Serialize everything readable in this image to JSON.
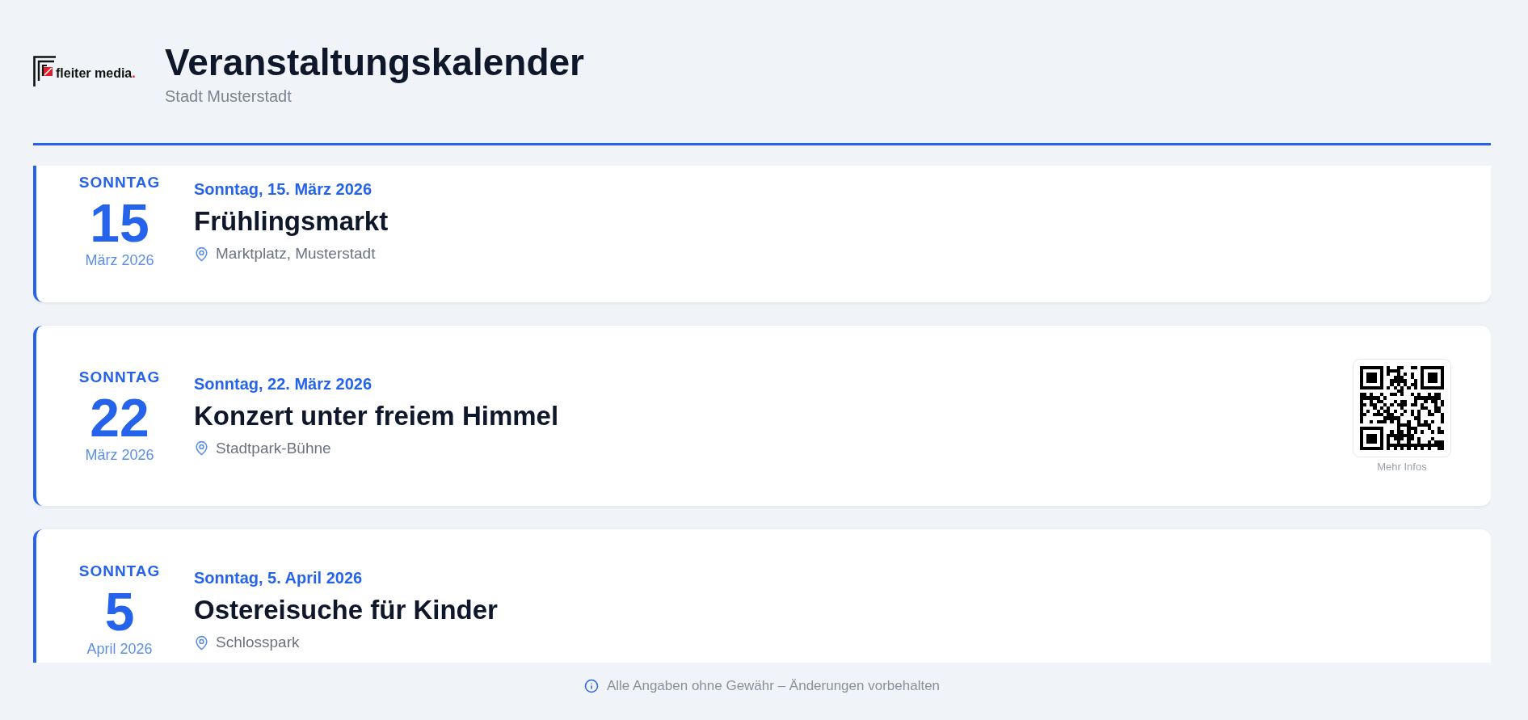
{
  "header": {
    "logo": {
      "text": "fleiter media",
      "accent": "."
    },
    "title": "Veranstaltungskalender",
    "subtitle": "Stadt Musterstadt"
  },
  "events": [
    {
      "weekday": "SONNTAG",
      "day": "15",
      "month_year": "März 2026",
      "date": "Sonntag, 15. März 2026",
      "title": "Frühlingsmarkt",
      "location": "Marktplatz, Musterstadt"
    },
    {
      "weekday": "SONNTAG",
      "day": "22",
      "month_year": "März 2026",
      "date": "Sonntag, 22. März 2026",
      "title": "Konzert unter freiem Himmel",
      "location": "Stadtpark-Bühne",
      "qr": {
        "caption": "Mehr Infos"
      }
    },
    {
      "weekday": "SONNTAG",
      "day": "5",
      "month_year": "April 2026",
      "date": "Sonntag, 5. April 2026",
      "title": "Ostereisuche für Kinder",
      "location": "Schlosspark"
    }
  ],
  "footer": {
    "note": "Alle Angaben ohne Gewähr – Änderungen vorbehalten"
  }
}
